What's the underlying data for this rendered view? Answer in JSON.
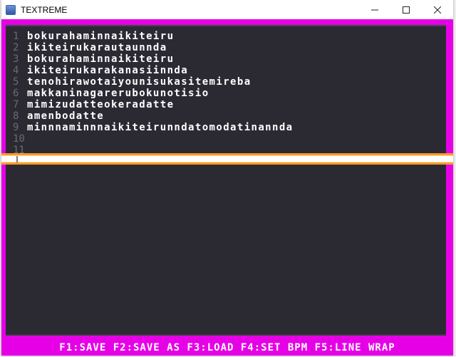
{
  "window": {
    "title": "TEXTREME",
    "minimize_glyph": "—",
    "maximize_glyph": "☐",
    "close_glyph": "✕"
  },
  "colors": {
    "frame": "#e600e6",
    "editor_bg": "#2b2a33",
    "text": "#ffffff",
    "line_number": "#6a6a73",
    "cursor_bar": "#ff9a2a"
  },
  "editor": {
    "lines": [
      {
        "number": "1",
        "text": "bokurahaminnaikiteiru"
      },
      {
        "number": "2",
        "text": "ikiteirukarautaunnda"
      },
      {
        "number": "3",
        "text": "bokurahaminnaikiteiru"
      },
      {
        "number": "4",
        "text": "ikiteirukarakanasiinnda"
      },
      {
        "number": "5",
        "text": "tenohirawotaiyounisukasitemireba"
      },
      {
        "number": "6",
        "text": "makkaninagarerubokunotisio"
      },
      {
        "number": "7",
        "text": "mimizudatteokeradatte"
      },
      {
        "number": "8",
        "text": "amenbodatte"
      },
      {
        "number": "9",
        "text": "minnnaminnnaikiteirunndatomodatinannda"
      },
      {
        "number": "10",
        "text": ""
      },
      {
        "number": "11",
        "text": ""
      }
    ]
  },
  "statusbar": {
    "text": "F1:SAVE F2:SAVE AS F3:LOAD F4:SET BPM F5:LINE WRAP"
  }
}
